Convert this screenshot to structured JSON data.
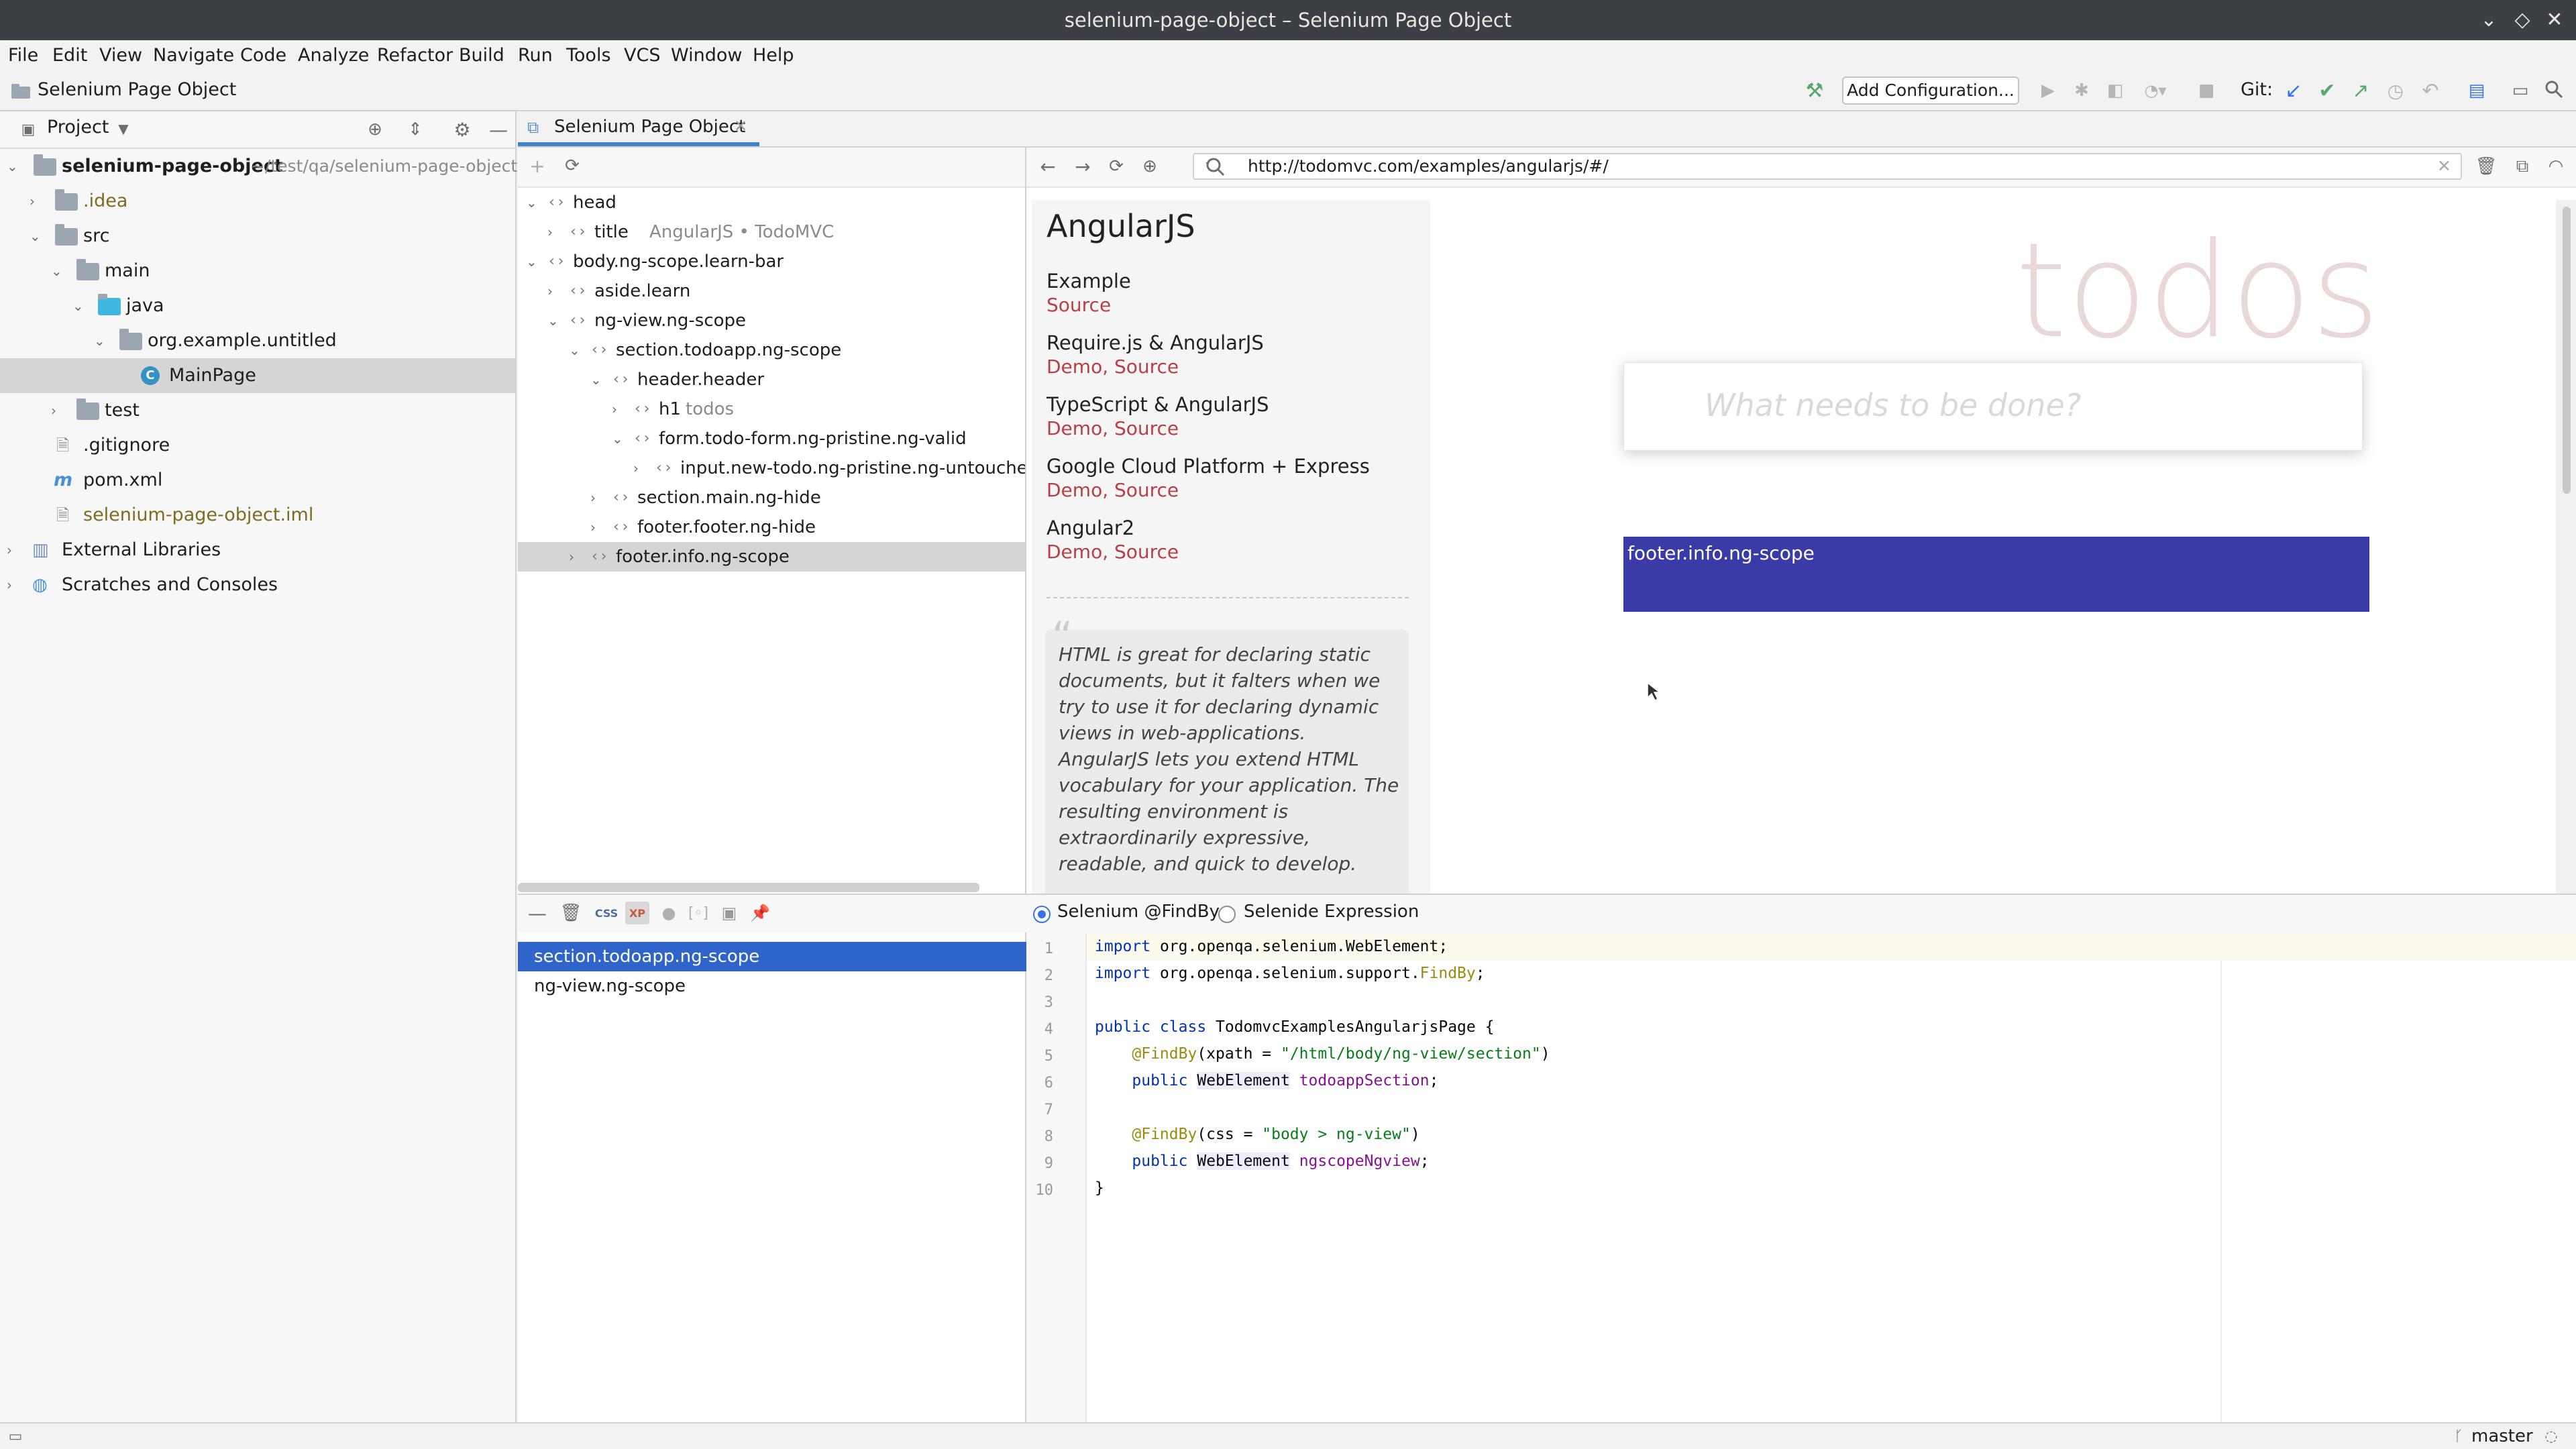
{
  "window": {
    "title": "selenium-page-object – Selenium Page Object"
  },
  "menu": [
    "File",
    "Edit",
    "View",
    "Navigate",
    "Code",
    "Analyze",
    "Refactor",
    "Build",
    "Run",
    "Tools",
    "VCS",
    "Window",
    "Help"
  ],
  "nav": {
    "breadcrumb": "Selenium Page Object",
    "add_config": "Add Configuration...",
    "git_label": "Git:"
  },
  "project": {
    "header": "Project",
    "root_name": "selenium-page-object",
    "root_path": "~/test/qa/selenium-page-object",
    "items": [
      ".idea",
      "src",
      "main",
      "java",
      "org.example.untitled",
      "MainPage",
      "test",
      ".gitignore",
      "pom.xml",
      "selenium-page-object.iml",
      "External Libraries",
      "Scratches and Consoles"
    ]
  },
  "tab": {
    "label": "Selenium Page Object"
  },
  "dom_tree": [
    {
      "tag": "head",
      "extra": ""
    },
    {
      "tag": "title",
      "extra": "AngularJS • TodoMVC"
    },
    {
      "tag": "body.ng-scope.learn-bar",
      "extra": ""
    },
    {
      "tag": "aside.learn",
      "extra": ""
    },
    {
      "tag": "ng-view.ng-scope",
      "extra": ""
    },
    {
      "tag": "section.todoapp.ng-scope",
      "extra": ""
    },
    {
      "tag": "header.header",
      "extra": ""
    },
    {
      "tag": "h1",
      "extra": "todos"
    },
    {
      "tag": "form.todo-form.ng-pristine.ng-valid",
      "extra": ""
    },
    {
      "tag": "input.new-todo.ng-pristine.ng-untouched.ng",
      "extra": ""
    },
    {
      "tag": "section.main.ng-hide",
      "extra": ""
    },
    {
      "tag": "footer.footer.ng-hide",
      "extra": ""
    },
    {
      "tag": "footer.info.ng-scope",
      "extra": ""
    }
  ],
  "browser": {
    "url": "http://todomvc.com/examples/angularjs/#/",
    "learn_title": "AngularJS",
    "example_label": "Example",
    "source_label": "Source",
    "links": [
      {
        "title": "Require.js & AngularJS",
        "sub": "Demo, Source"
      },
      {
        "title": "TypeScript & AngularJS",
        "sub": "Demo, Source"
      },
      {
        "title": "Google Cloud Platform + Express",
        "sub": "Demo, Source"
      },
      {
        "title": "Angular2",
        "sub": "Demo, Source"
      }
    ],
    "quote": "HTML is great for declaring static documents, but it falters when we try to use it for declaring dynamic views in web-applications. AngularJS lets you extend HTML vocabulary for your application. The resulting environment is extraordinarily expressive, readable, and quick to develop.",
    "todos_title": "todos",
    "new_todo_placeholder": "What needs to be done?",
    "highlight_label": "footer.info.ng-scope"
  },
  "selected_list": [
    "section.todoapp.ng-scope",
    "ng-view.ng-scope"
  ],
  "code_options": {
    "opt1": "Selenium @FindBy",
    "opt2": "Selenide Expression"
  },
  "line_numbers": [
    "1",
    "2",
    "3",
    "4",
    "5",
    "6",
    "7",
    "8",
    "9",
    "10"
  ],
  "status": {
    "branch": "master"
  }
}
